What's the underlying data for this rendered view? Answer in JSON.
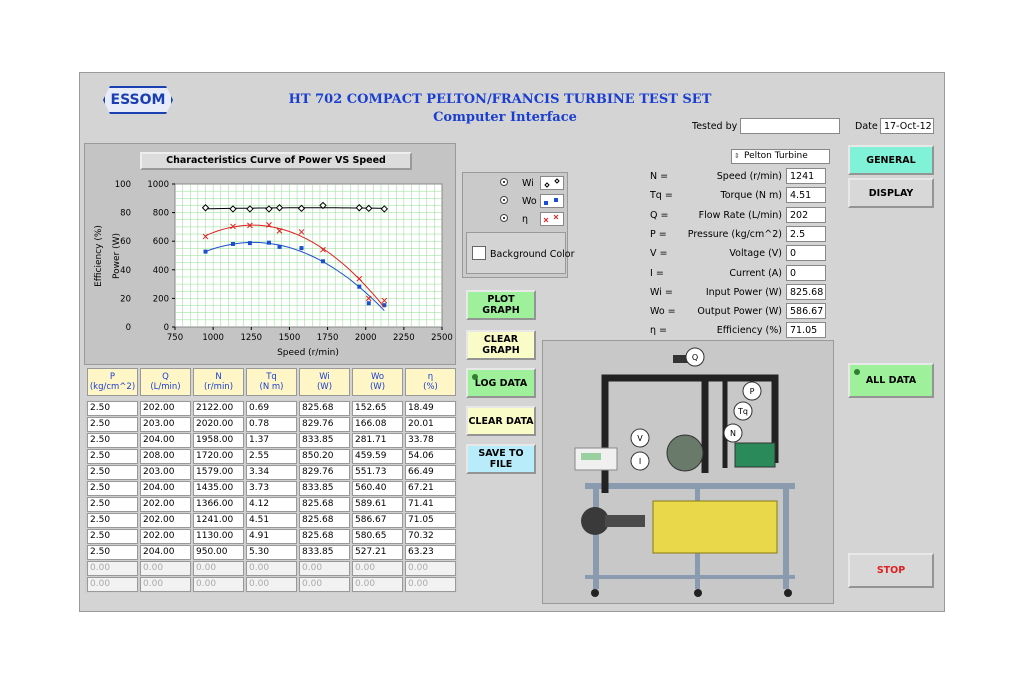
{
  "header": {
    "logo": "ESSOM",
    "title": "HT 702 COMPACT PELTON/FRANCIS TURBINE TEST SET",
    "subtitle": "Computer Interface",
    "tested_by_label": "Tested by",
    "tested_by_value": "",
    "date_label": "Date",
    "date_value": "17-Oct-12"
  },
  "chart_panel": {
    "title": "Characteristics Curve of Power VS Speed",
    "legend": [
      {
        "label": "Wi",
        "color": "#000000"
      },
      {
        "label": "Wo",
        "color": "#1a4fd0"
      },
      {
        "label": "η",
        "color": "#e02020"
      }
    ],
    "background_color_label": "Background Color"
  },
  "chart_data": {
    "type": "line",
    "xlabel": "Speed (r/min)",
    "ylabel": "Power (W)",
    "y2label": "Efficiency (%)",
    "xlim": [
      750,
      2500
    ],
    "ylim": [
      0,
      1000
    ],
    "y2lim": [
      0,
      100
    ],
    "xticks": [
      "750",
      "1000",
      "1250",
      "1500",
      "1750",
      "2000",
      "2250",
      "2500"
    ],
    "yticks": [
      "0",
      "200",
      "400",
      "600",
      "800",
      "1000"
    ],
    "y2ticks": [
      "0",
      "20",
      "40",
      "60",
      "80",
      "100"
    ],
    "x": [
      2122,
      2020,
      1958,
      1720,
      1579,
      1435,
      1366,
      1241,
      1130,
      950
    ],
    "series": [
      {
        "name": "Wi",
        "color": "#000000",
        "marker": "diamond",
        "axis": "left",
        "values": [
          825.68,
          829.76,
          833.85,
          850.2,
          829.76,
          833.85,
          825.68,
          825.68,
          825.68,
          833.85
        ]
      },
      {
        "name": "Wo",
        "color": "#1a4fd0",
        "marker": "square",
        "axis": "left",
        "values": [
          152.65,
          166.08,
          281.71,
          459.59,
          551.73,
          560.4,
          589.61,
          586.67,
          580.65,
          527.21
        ]
      },
      {
        "name": "η",
        "color": "#e02020",
        "marker": "x",
        "axis": "right",
        "values": [
          18.49,
          20.01,
          33.78,
          54.06,
          66.49,
          67.21,
          71.41,
          71.05,
          70.32,
          63.23
        ]
      }
    ]
  },
  "readings": {
    "turbine_select": "Pelton Turbine",
    "rows": [
      {
        "sym": "N =",
        "label": "Speed (r/min)",
        "value": "1241"
      },
      {
        "sym": "Tq =",
        "label": "Torque (N m)",
        "value": "4.51"
      },
      {
        "sym": "Q =",
        "label": "Flow Rate (L/min)",
        "value": "202"
      },
      {
        "sym": "P =",
        "label": "Pressure (kg/cm^2)",
        "value": "2.5"
      },
      {
        "sym": "V =",
        "label": "Voltage (V)",
        "value": "0"
      },
      {
        "sym": "I =",
        "label": "Current (A)",
        "value": "0"
      },
      {
        "sym": "Wi =",
        "label": "Input Power (W)",
        "value": "825.68"
      },
      {
        "sym": "Wo =",
        "label": "Output Power (W)",
        "value": "586.67"
      },
      {
        "sym": "η =",
        "label": "Efficiency (%)",
        "value": "71.05"
      }
    ]
  },
  "buttons": {
    "plot_graph": "PLOT GRAPH",
    "clear_graph": "CLEAR GRAPH",
    "log_data": "LOG DATA",
    "clear_data": "CLEAR DATA",
    "save_to_file": "SAVE TO FILE",
    "general": "GENERAL",
    "display": "DISPLAY",
    "all_data": "ALL DATA",
    "stop": "STOP"
  },
  "table": {
    "headers": [
      [
        "P",
        "(kg/cm^2)"
      ],
      [
        "Q",
        "(L/min)"
      ],
      [
        "N",
        "(r/min)"
      ],
      [
        "Tq",
        "(N m)"
      ],
      [
        "Wi",
        "(W)"
      ],
      [
        "Wo",
        "(W)"
      ],
      [
        "η",
        "(%)"
      ]
    ],
    "rows": [
      [
        "2.50",
        "202.00",
        "2122.00",
        "0.69",
        "825.68",
        "152.65",
        "18.49"
      ],
      [
        "2.50",
        "203.00",
        "2020.00",
        "0.78",
        "829.76",
        "166.08",
        "20.01"
      ],
      [
        "2.50",
        "204.00",
        "1958.00",
        "1.37",
        "833.85",
        "281.71",
        "33.78"
      ],
      [
        "2.50",
        "208.00",
        "1720.00",
        "2.55",
        "850.20",
        "459.59",
        "54.06"
      ],
      [
        "2.50",
        "203.00",
        "1579.00",
        "3.34",
        "829.76",
        "551.73",
        "66.49"
      ],
      [
        "2.50",
        "204.00",
        "1435.00",
        "3.73",
        "833.85",
        "560.40",
        "67.21"
      ],
      [
        "2.50",
        "202.00",
        "1366.00",
        "4.12",
        "825.68",
        "589.61",
        "71.41"
      ],
      [
        "2.50",
        "202.00",
        "1241.00",
        "4.51",
        "825.68",
        "586.67",
        "71.05"
      ],
      [
        "2.50",
        "202.00",
        "1130.00",
        "4.91",
        "825.68",
        "580.65",
        "70.32"
      ],
      [
        "2.50",
        "204.00",
        "950.00",
        "5.30",
        "833.85",
        "527.21",
        "63.23"
      ]
    ],
    "empty_rows": [
      [
        "0.00",
        "0.00",
        "0.00",
        "0.00",
        "0.00",
        "0.00",
        "0.00"
      ],
      [
        "0.00",
        "0.00",
        "0.00",
        "0.00",
        "0.00",
        "0.00",
        "0.00"
      ]
    ]
  },
  "diagram": {
    "labels": [
      "Q",
      "P",
      "Tq",
      "N",
      "V",
      "I"
    ]
  }
}
